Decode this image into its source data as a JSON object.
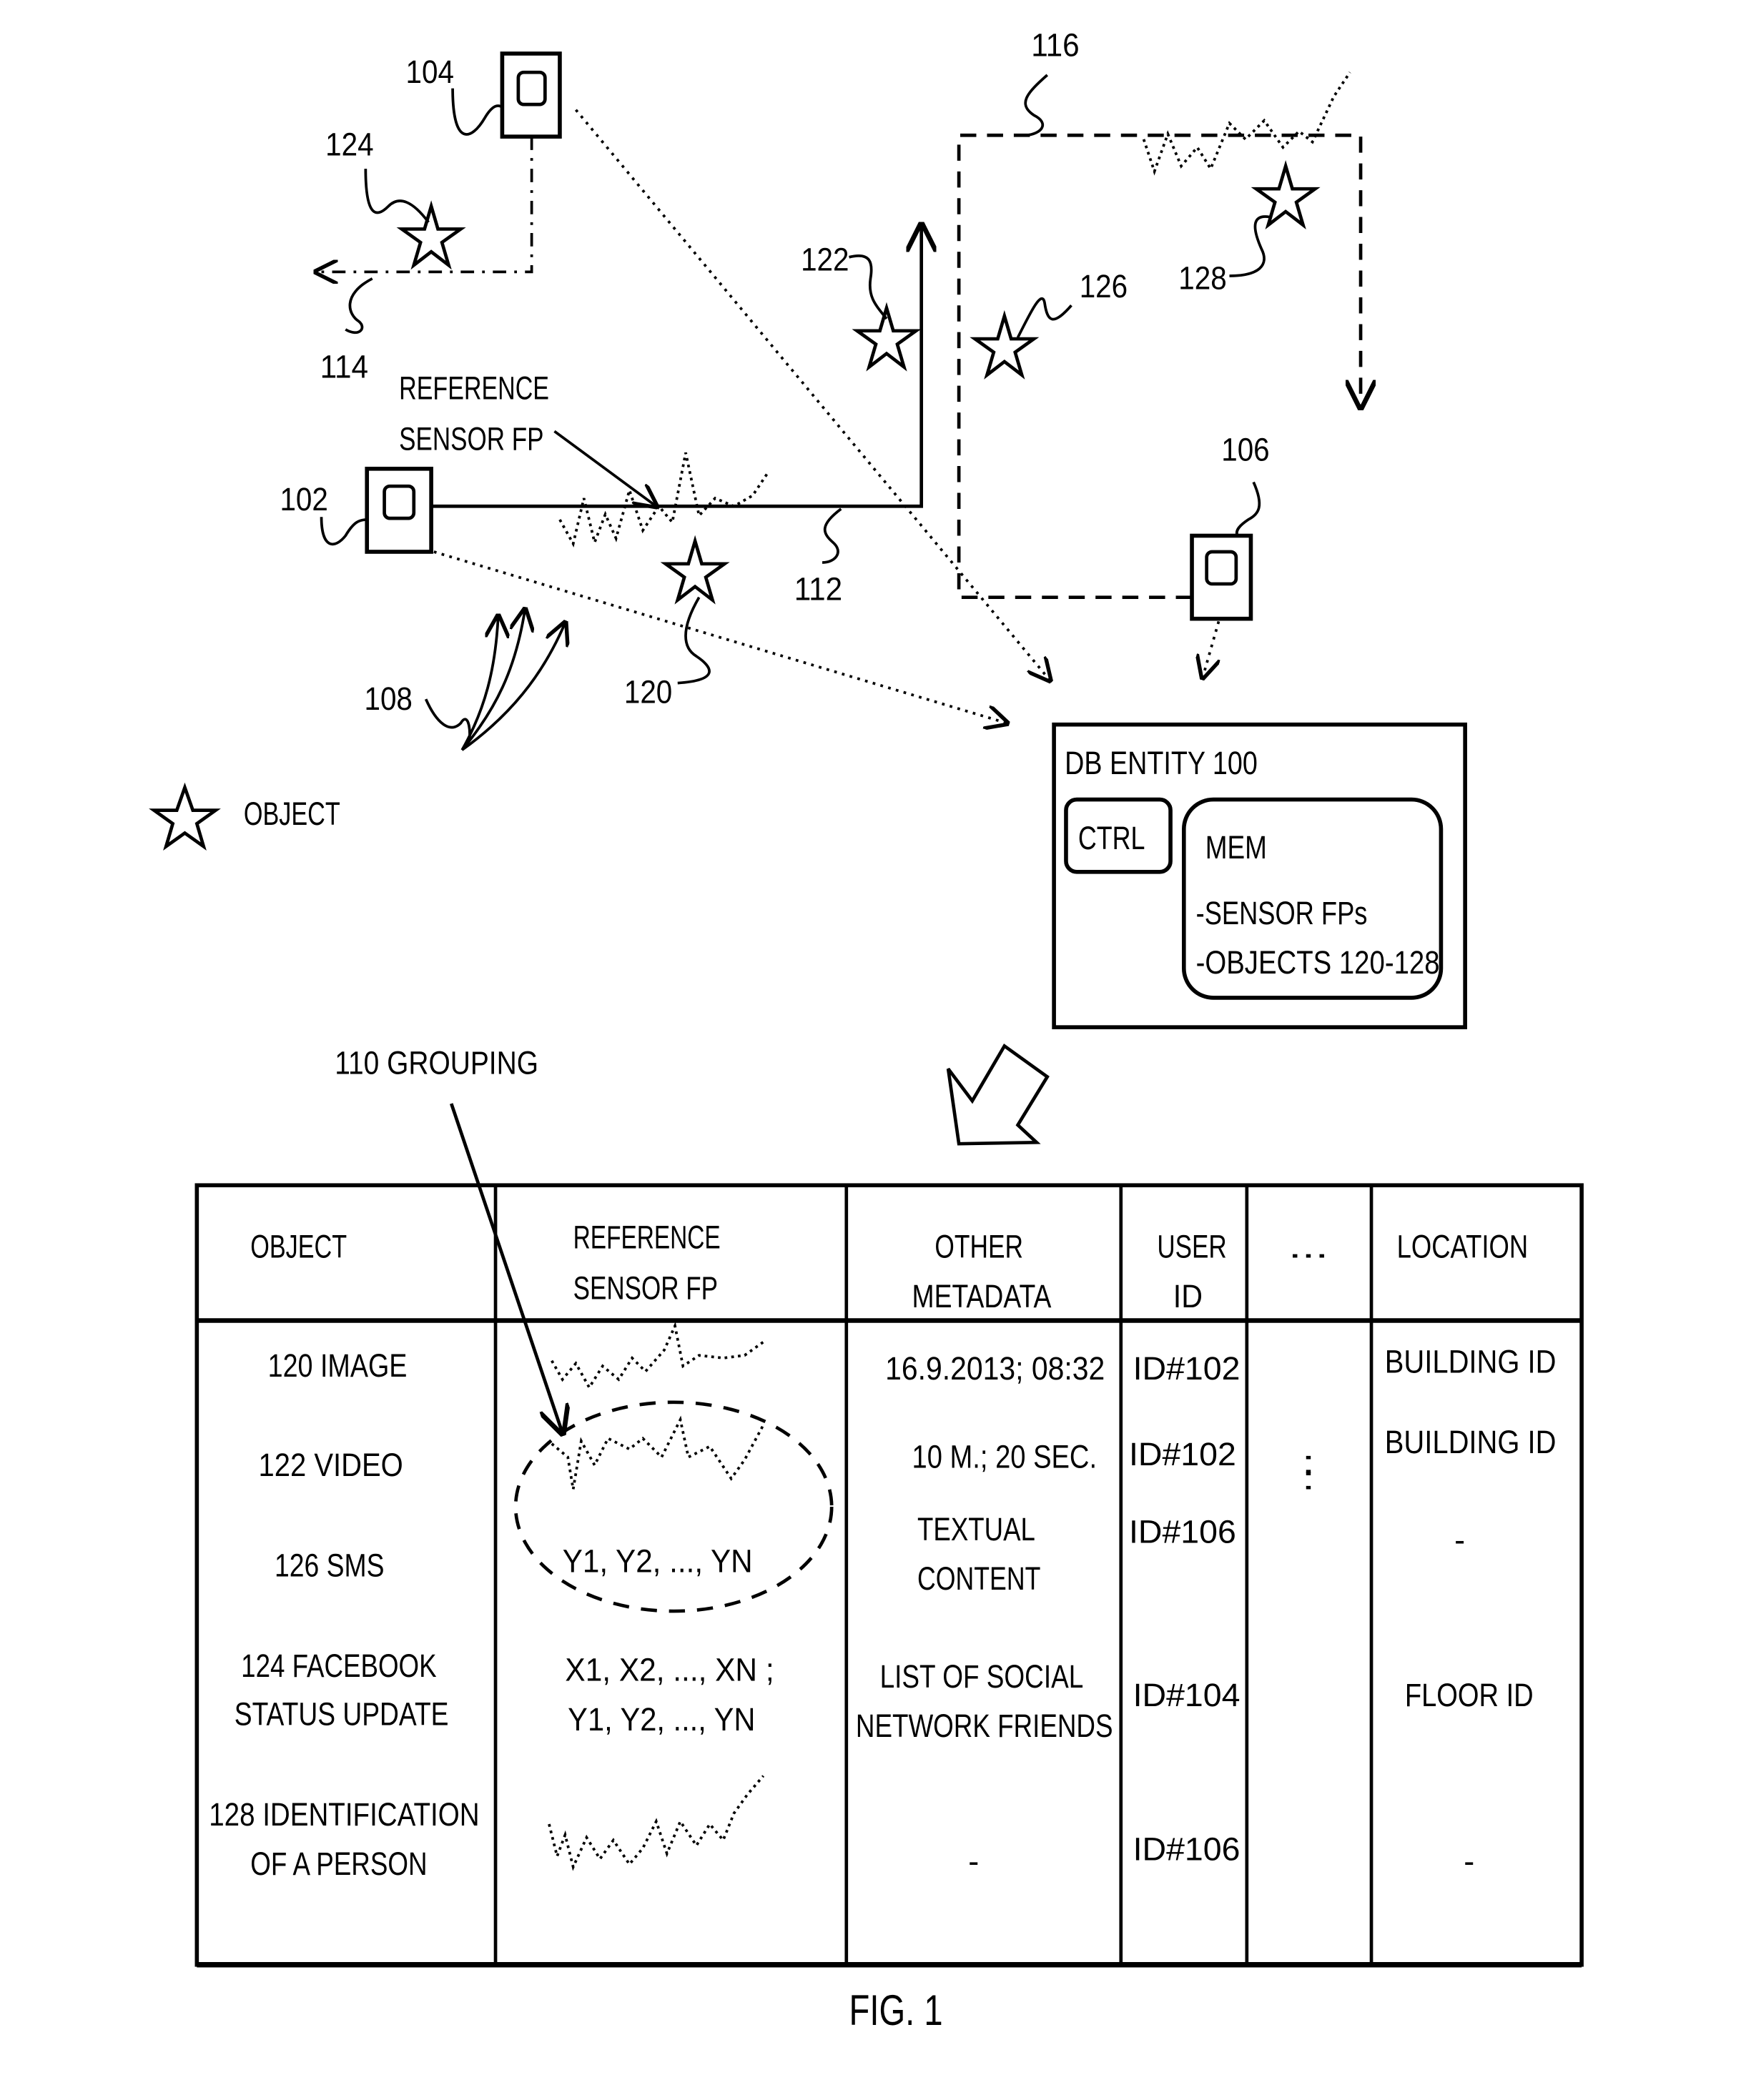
{
  "figure": {
    "caption": "FIG. 1",
    "legend": {
      "icon": "star-icon",
      "label": "OBJECT"
    },
    "ink_color": "#000000",
    "background_color": "#ffffff"
  },
  "devices": [
    {
      "ref": "102",
      "icon": "mobile-device-icon"
    },
    {
      "ref": "104",
      "icon": "mobile-device-icon"
    },
    {
      "ref": "106",
      "icon": "mobile-device-icon"
    }
  ],
  "objects": [
    {
      "ref": "120",
      "icon": "star-icon"
    },
    {
      "ref": "122",
      "icon": "star-icon"
    },
    {
      "ref": "124",
      "icon": "star-icon"
    },
    {
      "ref": "126",
      "icon": "star-icon"
    },
    {
      "ref": "128",
      "icon": "star-icon"
    }
  ],
  "paths": [
    {
      "ref": "112",
      "style": "solid"
    },
    {
      "ref": "114",
      "style": "dash-dot"
    },
    {
      "ref": "116",
      "style": "dashed"
    }
  ],
  "labels": {
    "ref_104": "104",
    "ref_124": "124",
    "ref_114": "114",
    "ref_102": "102",
    "ref_108": "108",
    "ref_120": "120",
    "ref_112": "112",
    "ref_122": "122",
    "ref_126": "126",
    "ref_116": "116",
    "ref_128": "128",
    "ref_106": "106",
    "reference_sensor_fp_line1": "REFERENCE",
    "reference_sensor_fp_line2": "SENSOR FP",
    "grouping": "110 GROUPING"
  },
  "db_entity": {
    "title": "DB ENTITY 100",
    "ctrl": "CTRL",
    "mem": {
      "title": "MEM",
      "items": [
        "-SENSOR FPs",
        "-OBJECTS 120-128"
      ]
    }
  },
  "table": {
    "headers": [
      [
        "OBJECT"
      ],
      [
        "REFERENCE",
        "SENSOR FP"
      ],
      [
        "OTHER",
        "METADATA"
      ],
      [
        "USER",
        "ID"
      ],
      [
        "..."
      ],
      [
        "LOCATION"
      ]
    ],
    "rows": [
      {
        "object": [
          "120 IMAGE"
        ],
        "sensor_fp": {
          "type": "waveform"
        },
        "metadata": [
          "16.9.2013; 08:32"
        ],
        "user_id": "ID#102",
        "location": [
          "BUILDING ID"
        ]
      },
      {
        "object": [
          "122  VIDEO"
        ],
        "sensor_fp": {
          "type": "waveform"
        },
        "metadata": [
          "10 M.; 20 SEC."
        ],
        "user_id": "ID#102",
        "location": [
          "BUILDING ID"
        ]
      },
      {
        "object": [
          "126 SMS"
        ],
        "sensor_fp": {
          "type": "text",
          "lines": [
            "Y1, Y2, ..., YN"
          ]
        },
        "metadata": [
          "TEXTUAL",
          "CONTENT"
        ],
        "user_id": "ID#106",
        "location": [
          "-"
        ]
      },
      {
        "object": [
          "124 FACEBOOK",
          "STATUS UPDATE"
        ],
        "sensor_fp": {
          "type": "text",
          "lines": [
            "X1, X2, ..., XN ;",
            "Y1, Y2, ..., YN"
          ]
        },
        "metadata": [
          "LIST OF SOCIAL",
          "NETWORK FRIENDS"
        ],
        "user_id": "ID#104",
        "location": [
          "FLOOR ID"
        ]
      },
      {
        "object": [
          "128 IDENTIFICATION",
          "OF A PERSON"
        ],
        "sensor_fp": {
          "type": "waveform"
        },
        "metadata": [
          "-"
        ],
        "user_id": "ID#106",
        "location": [
          "-"
        ]
      }
    ],
    "ellipsis_vertical": ":"
  }
}
